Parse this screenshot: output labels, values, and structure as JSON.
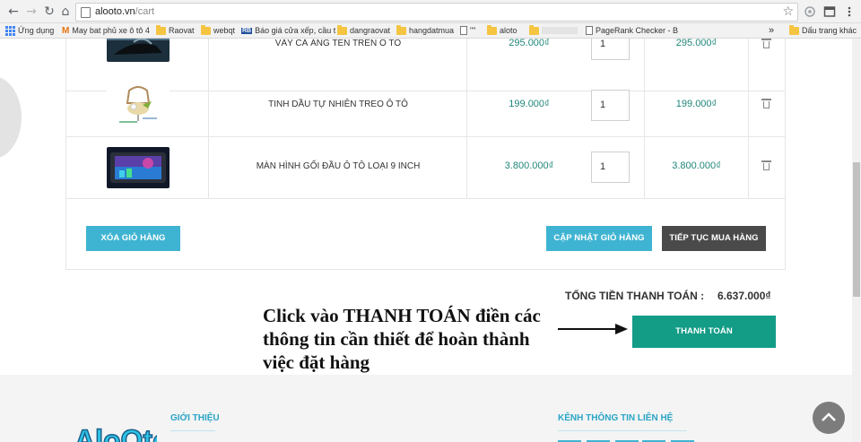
{
  "browser": {
    "url_host": "alooto.vn",
    "url_path": "/cart",
    "bookmarks": [
      {
        "label": "Ứng dụng",
        "icon": "apps-icon"
      },
      {
        "label": "May bat phủ xe ô tô 4",
        "icon": "m-logo-icon"
      },
      {
        "label": "Raovat",
        "icon": "folder-icon"
      },
      {
        "label": "webqt",
        "icon": "folder-icon"
      },
      {
        "label": "Báo giá cửa xếp, cầu t",
        "icon": "rb-logo-icon"
      },
      {
        "label": "dangraovat",
        "icon": "folder-icon"
      },
      {
        "label": "hangdatmua",
        "icon": "folder-icon"
      },
      {
        "label": "\"\"",
        "icon": "document-icon"
      },
      {
        "label": "aloto",
        "icon": "folder-icon"
      },
      {
        "label": "PageRank Checker - B",
        "icon": "document-icon"
      },
      {
        "label": "»",
        "icon": "more-icon"
      },
      {
        "label": "Dấu trang khác",
        "icon": "folder-icon"
      }
    ]
  },
  "cart": {
    "items": [
      {
        "name": "VÂY CÁ ĂNG TEN TRÊN Ô TÔ",
        "price": "295.000₫",
        "quantity": "1",
        "total": "295.000₫"
      },
      {
        "name": "TINH DẦU TỰ NHIÊN TREO Ô TÔ",
        "price": "199.000₫",
        "quantity": "1",
        "total": "199.000₫"
      },
      {
        "name": "MÀN HÌNH GỐI ĐẦU Ô TÔ LOẠI 9 INCH",
        "price": "3.800.000₫",
        "quantity": "1",
        "total": "3.800.000₫"
      }
    ],
    "clear_label": "XÓA GIỎ HÀNG",
    "update_label": "CẬP NHẬT GIỎ HÀNG",
    "continue_label": "TIẾP TỤC MUA HÀNG",
    "total_label": "TỔNG TIỀN THANH TOÁN :",
    "total_value": "6.637.000₫",
    "checkout_label": "THANH TOÁN"
  },
  "annotation": {
    "line1": "Click vào THANH TOÁN điền các",
    "line2": "thông tin cần thiết để hoàn thành",
    "line3": "việc đặt hàng"
  },
  "footer": {
    "about_heading": "GIỚI THIỆU",
    "contact_heading": "KÊNH THÔNG TIN LIÊN HỆ",
    "logo_text": "AloOto"
  },
  "colors": {
    "accent_teal": "#3fb4d2",
    "price_green": "#21867a",
    "checkout_green": "#139c86",
    "dark_button": "#4a4a4a"
  }
}
